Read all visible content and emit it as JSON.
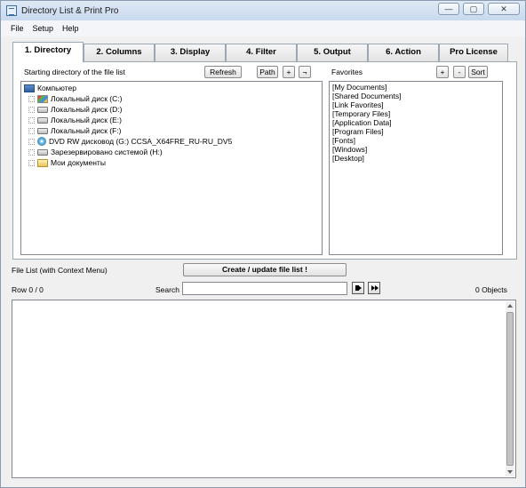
{
  "window": {
    "title": "Directory List & Print Pro",
    "buttons": [
      "—",
      "▢",
      "✕"
    ]
  },
  "menu": [
    "File",
    "Setup",
    "Help"
  ],
  "tabs": [
    "1. Directory",
    "2. Columns",
    "3. Display",
    "4. Filter",
    "5. Output",
    "6. Action",
    "Pro License"
  ],
  "directory": {
    "label": "Starting directory of the file list",
    "refresh": "Refresh",
    "path": "Path",
    "plus": "+",
    "toggle": "¬",
    "tree": [
      "Компьютер",
      "Локальный диск (C:)",
      "Локальный диск (D:)",
      "Локальный диск (E:)",
      "Локальный диск (F:)",
      "DVD RW дисковод (G:) CCSA_X64FRE_RU-RU_DV5",
      "Зарезервировано системой (H:)",
      "Мои документы"
    ]
  },
  "favorites": {
    "label": "Favorites",
    "plus": "+",
    "minus": "-",
    "sort": "Sort",
    "items": [
      "[My Documents]",
      "[Shared Documents]",
      "[Link Favorites]",
      "[Temporary Files]",
      "[Application Data]",
      "[Program Files]",
      "[Fonts]",
      "[Windows]",
      "[Desktop]"
    ]
  },
  "filelist": {
    "label": "File List (with Context Menu)",
    "create": "Create / update file list !",
    "row": "Row 0 / 0",
    "search": "Search",
    "search_value": "",
    "objects": "0 Objects"
  }
}
